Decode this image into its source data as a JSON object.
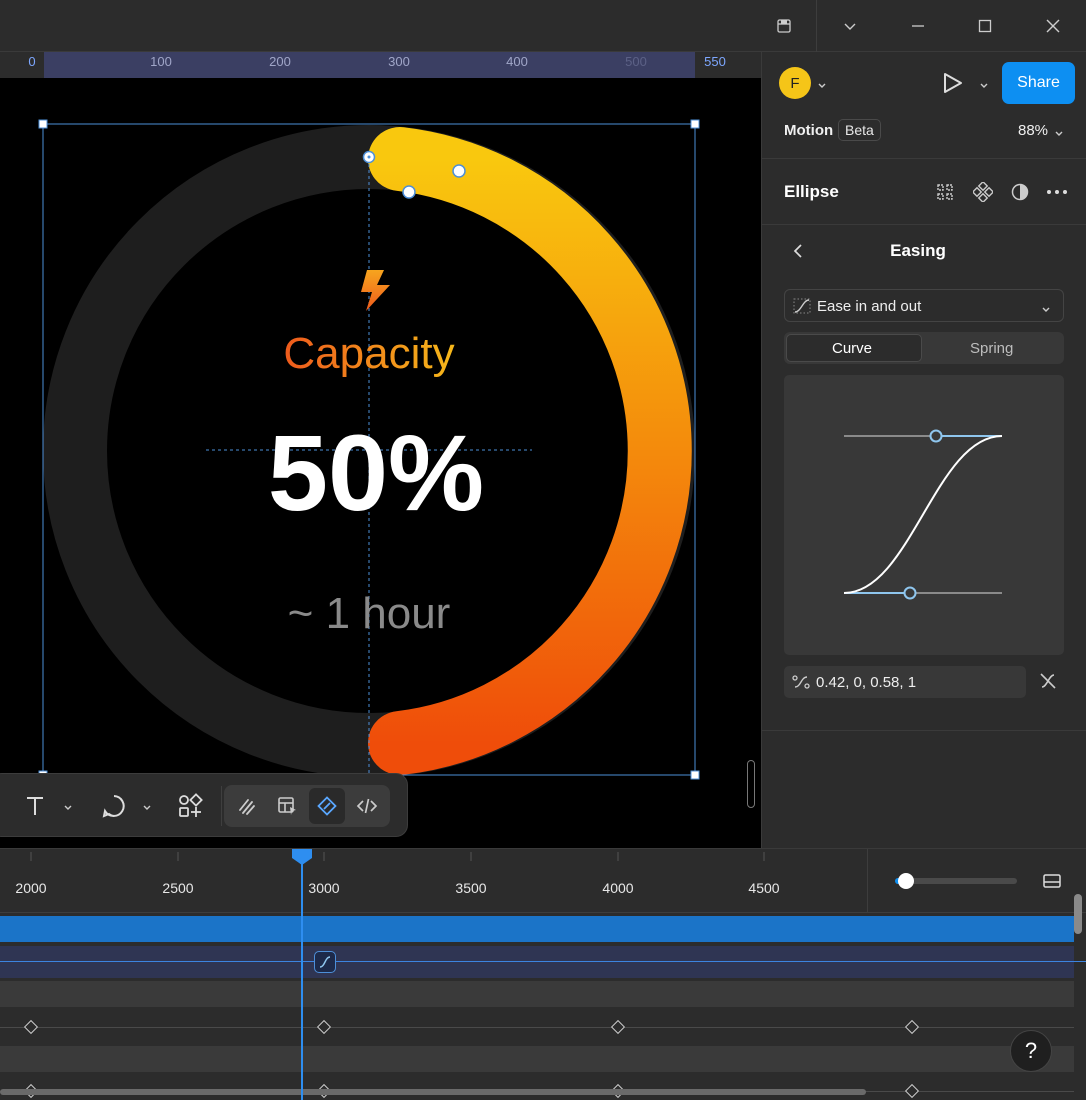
{
  "ruler": {
    "ticks": [
      "0",
      "100",
      "200",
      "300",
      "400",
      "500",
      "550"
    ]
  },
  "canvas": {
    "widget": {
      "title": "Capacity",
      "value": "50%",
      "subtitle": "~ 1 hour",
      "progress": 0.5,
      "gradient_start": "#f9c80e",
      "gradient_end": "#ef4d0a",
      "track_color": "#1e1e1e"
    },
    "icons": [
      "lightning-icon"
    ]
  },
  "header": {
    "avatar_initial": "F",
    "share_label": "Share",
    "motion_label": "Motion",
    "beta_label": "Beta",
    "zoom": "88%"
  },
  "layer": {
    "name": "Ellipse"
  },
  "easing": {
    "title": "Easing",
    "preset": "Ease in and out",
    "tabs": [
      "Curve",
      "Spring"
    ],
    "active_tab": "Curve",
    "bezier": "0.42, 0, 0.58, 1"
  },
  "toolbar": {
    "icons": [
      "text-icon",
      "shape-icon",
      "components-icon",
      "pen-icon",
      "table-icon",
      "motion-icon",
      "code-icon"
    ]
  },
  "timeline": {
    "ticks": [
      "2000",
      "2500",
      "3000",
      "3500",
      "4000",
      "4500"
    ],
    "help": "?"
  },
  "colors": {
    "accent": "#0d8ff2",
    "panel_bg": "#2c2c2c",
    "canvas_bg": "#000000",
    "selection": "#4d8fd8"
  }
}
